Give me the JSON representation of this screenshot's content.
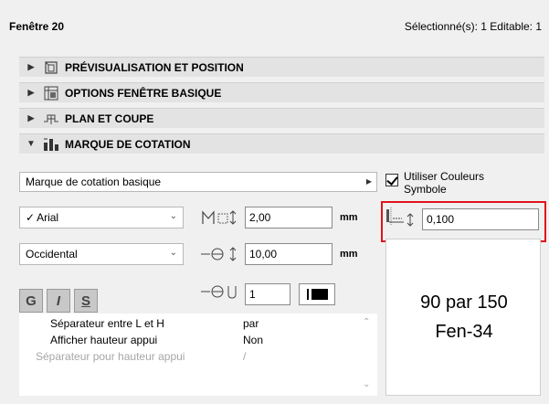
{
  "header": {
    "title": "Fenêtre 20",
    "selection_status": "Sélectionné(s): 1 Editable: 1"
  },
  "sections": [
    {
      "label": "PRÉVISUALISATION ET POSITION",
      "expanded": false,
      "icon": "preview-position-icon"
    },
    {
      "label": "OPTIONS FENÊTRE BASIQUE",
      "expanded": false,
      "icon": "window-options-icon"
    },
    {
      "label": "PLAN ET COUPE",
      "expanded": false,
      "icon": "plan-section-icon"
    },
    {
      "label": "MARQUE DE COTATION",
      "expanded": true,
      "icon": "dimension-marker-icon"
    }
  ],
  "marker": {
    "type_dropdown": "Marque de cotation basique",
    "use_symbol_colors_label": "Utiliser Couleurs Symbole",
    "use_symbol_colors_checked": true,
    "font_name": "Arial",
    "font_check": "✓",
    "charset": "Occidental",
    "font_size_value": "2,00",
    "font_size_unit": "mm",
    "offset_value": "10,00",
    "offset_unit": "mm",
    "pen_value": "1",
    "pen_line_value": "0,100",
    "format_buttons": [
      "G",
      "I",
      "S"
    ]
  },
  "settings_list": [
    {
      "key": "Séparateur entre L et H",
      "value": "par",
      "disabled": false
    },
    {
      "key": "Afficher hauteur appui",
      "value": "Non",
      "disabled": false
    },
    {
      "key": "Séparateur pour hauteur appui",
      "value": "/",
      "disabled": true
    }
  ],
  "preview": {
    "line1": "90 par 150",
    "line2": "Fen-34"
  },
  "colors": {
    "highlight": "#e0131a",
    "section_bg": "#e3e3e3",
    "panel_bg": "#f0f0f0"
  }
}
